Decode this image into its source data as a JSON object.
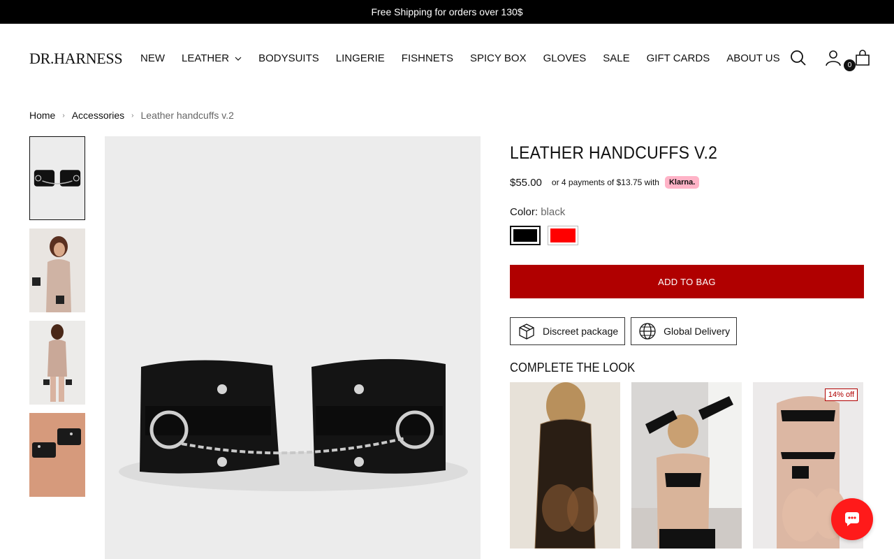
{
  "announcement": "Free Shipping for orders over 130$",
  "brand": {
    "logo": "DR.HARNESS"
  },
  "nav": [
    {
      "label": "NEW"
    },
    {
      "label": "LEATHER",
      "has_dropdown": true
    },
    {
      "label": "BODYSUITS"
    },
    {
      "label": "LINGERIE"
    },
    {
      "label": "FISHNETS"
    },
    {
      "label": "SPICY BOX"
    },
    {
      "label": "GLOVES"
    },
    {
      "label": "SALE"
    },
    {
      "label": "GIFT CARDS"
    },
    {
      "label": "ABOUT US"
    }
  ],
  "header_icons": [
    "search-icon",
    "account-icon",
    "bag-icon"
  ],
  "cart": {
    "count": "0"
  },
  "breadcrumb": {
    "home": "Home",
    "category": "Accessories",
    "current": "Leather handcuffs v.2"
  },
  "product": {
    "title": "LEATHER HANDCUFFS V.2",
    "price": "$55.00",
    "klarna_text": "or 4 payments of $13.75 with",
    "klarna_brand": "Klarna.",
    "color_label": "Color:",
    "color_value": "black",
    "swatches": [
      {
        "name": "black",
        "hex": "#000000",
        "selected": true
      },
      {
        "name": "red",
        "hex": "#ff0000",
        "selected": false
      }
    ],
    "add_to_bag": "ADD TO BAG",
    "features": [
      "Discreet package",
      "Global Delivery"
    ]
  },
  "complete_the_look": {
    "title": "COMPLETE THE LOOK",
    "items": [
      {
        "badge": ""
      },
      {
        "badge": ""
      },
      {
        "badge": "14% off"
      }
    ]
  },
  "colors": {
    "accent": "#b00000",
    "announcement_bg": "#000000",
    "klarna_pink": "#ffb3c7",
    "chat_button": "#ff1a1a"
  }
}
